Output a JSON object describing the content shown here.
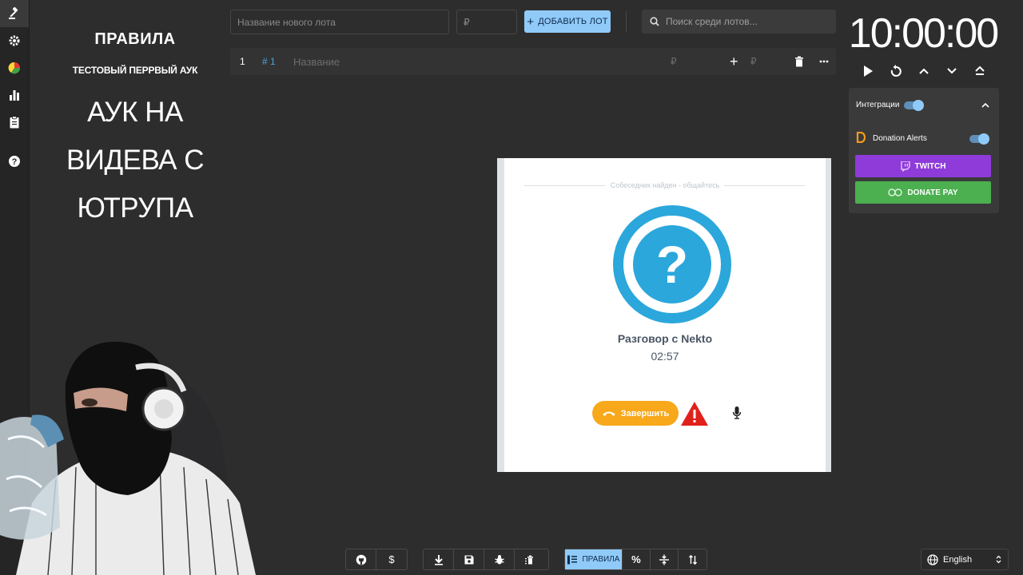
{
  "rules": {
    "title": "ПРАВИЛА",
    "subtitle": "ТЕСТОВЫЙ ПЕРРВЫЙ АУК",
    "lines": [
      "АУК НА",
      "ВИДЕВА С",
      "ЮТРУПА"
    ]
  },
  "top_bar": {
    "lot_name_placeholder": "Название нового лота",
    "amount_placeholder": "₽",
    "add_lot_label": "ДОБАВИТЬ ЛОТ",
    "search_placeholder": "Поиск среди лотов..."
  },
  "lot": {
    "index": "1",
    "id": "# 1",
    "name_placeholder": "Название",
    "currency": "₽",
    "add_currency": "₽"
  },
  "timer": {
    "value": "10:00:00"
  },
  "integrations": {
    "title": "Интеграции",
    "enabled": true,
    "donation_alerts_label": "Donation Alerts",
    "donation_alerts_enabled": true,
    "twitch_label": "TWITCH",
    "donatepay_label": "DONATE PAY",
    "colors": {
      "twitch": "#8e3bd9",
      "donatepay": "#4caf50",
      "accent": "#90caf9"
    }
  },
  "popup": {
    "header": "Собеседник найден - общайтесь",
    "title": "Разговор с Nekto",
    "time": "02:57",
    "end_label": "Завершить"
  },
  "bottom_toolbar": {
    "rules_label": "ПРАВИЛА",
    "percent_label": "%",
    "dollar_label": "$"
  },
  "language": {
    "selected": "English"
  }
}
